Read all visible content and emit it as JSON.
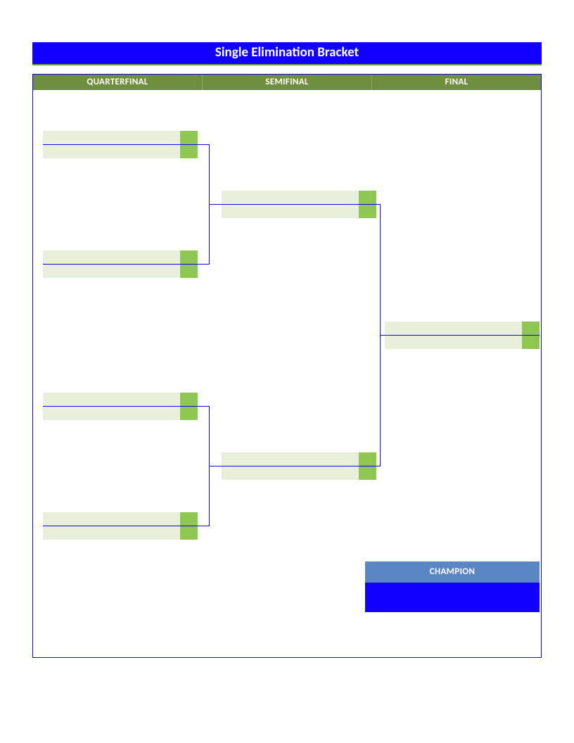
{
  "title": "Single Elimination Bracket",
  "columns": {
    "qf": "QUARTERFINAL",
    "sf": "SEMIFINAL",
    "f": "FINAL"
  },
  "champion": {
    "label": "CHAMPION",
    "name": ""
  },
  "matches": {
    "qf1": {
      "p1": "",
      "s1": "",
      "p2": "",
      "s2": ""
    },
    "qf2": {
      "p1": "",
      "s1": "",
      "p2": "",
      "s2": ""
    },
    "qf3": {
      "p1": "",
      "s1": "",
      "p2": "",
      "s2": ""
    },
    "qf4": {
      "p1": "",
      "s1": "",
      "p2": "",
      "s2": ""
    },
    "sf1": {
      "p1": "",
      "s1": "",
      "p2": "",
      "s2": ""
    },
    "sf2": {
      "p1": "",
      "s1": "",
      "p2": "",
      "s2": ""
    },
    "final": {
      "p1": "",
      "s1": "",
      "p2": "",
      "s2": ""
    }
  }
}
